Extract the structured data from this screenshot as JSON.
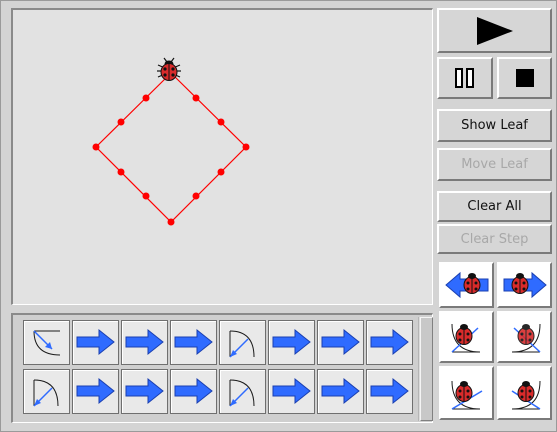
{
  "controls": {
    "show_leaf": "Show Leaf",
    "move_leaf": "Move Leaf",
    "clear_all": "Clear All",
    "clear_step": "Clear Step",
    "move_leaf_enabled": false,
    "clear_step_enabled": false
  },
  "program": {
    "row1": [
      "turn-left",
      "forward",
      "forward",
      "forward",
      "turn-right",
      "forward",
      "forward",
      "forward"
    ],
    "row2": [
      "turn-right",
      "forward",
      "forward",
      "forward",
      "turn-right",
      "forward",
      "forward",
      "forward"
    ]
  },
  "command_palette": [
    "move-back",
    "move-forward",
    "turn-left-small",
    "turn-right-small",
    "turn-left-large",
    "turn-right-large"
  ],
  "colors": {
    "path": "#ff0000",
    "arrow": "#2f6bff",
    "ladybug": "#d92b2b"
  }
}
